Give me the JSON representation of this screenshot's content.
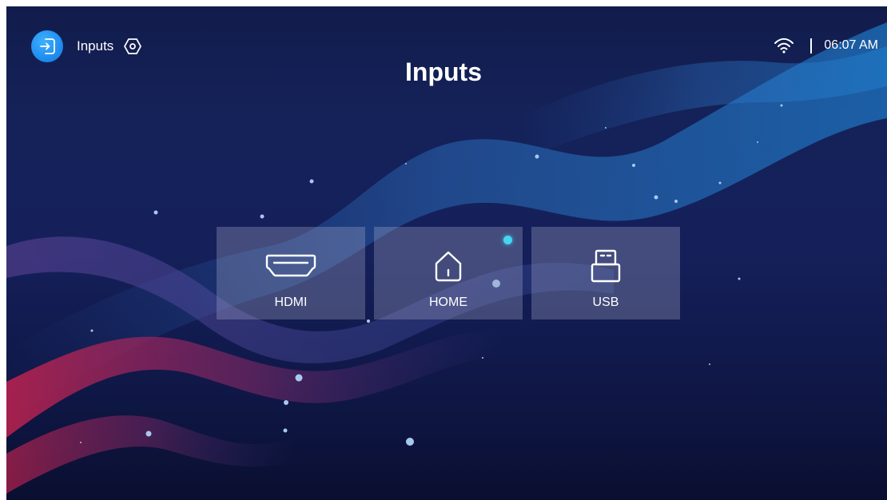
{
  "header": {
    "section_label": "Inputs",
    "input_icon": "input-arrow-icon",
    "settings_icon": "hexagon-settings-icon",
    "wifi_icon": "wifi-icon",
    "time": "06:07 AM"
  },
  "page": {
    "title": "Inputs"
  },
  "sources": [
    {
      "label": "HDMI",
      "icon": "hdmi-icon",
      "active": false
    },
    {
      "label": "HOME",
      "icon": "home-icon",
      "active": true
    },
    {
      "label": "USB",
      "icon": "usb-icon",
      "active": false
    }
  ],
  "colors": {
    "background": "#15205a",
    "accent_blue": "#1f8ef0",
    "active_indicator": "#45d6f2",
    "tile": "#8a8fb3"
  }
}
